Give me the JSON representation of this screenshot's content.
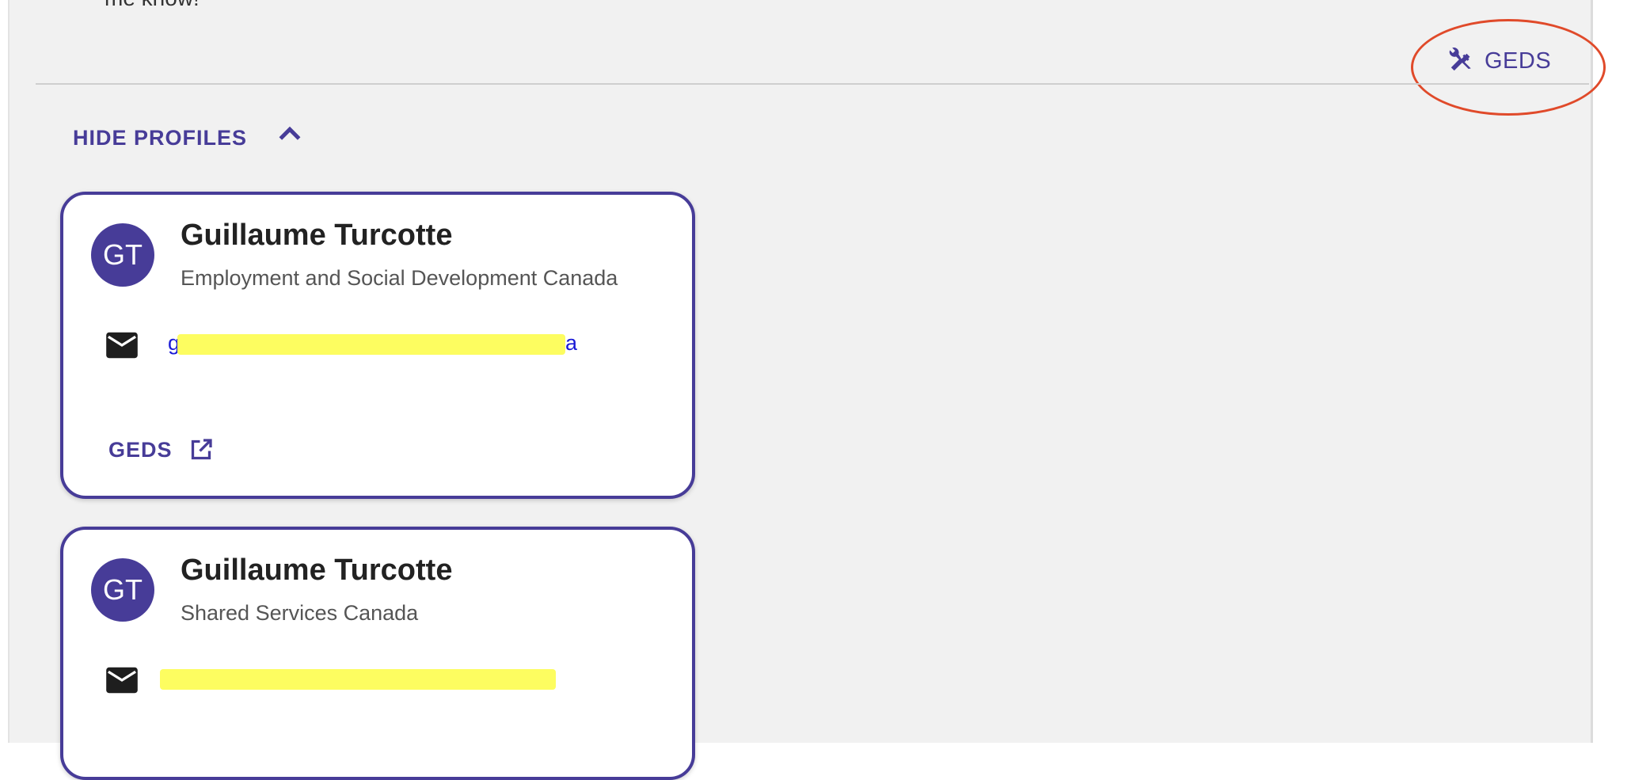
{
  "top_text": "me know!",
  "top_button": {
    "label": "GEDS",
    "icon": "tools-icon"
  },
  "annotation": {
    "color": "#e04a2a"
  },
  "hide_profiles": {
    "label": "HIDE PROFILES",
    "icon": "chevron-up-icon"
  },
  "colors": {
    "accent": "#473c98",
    "panel_bg": "#f1f1f1",
    "link": "#1a1ad6",
    "redaction": "#fdfd60"
  },
  "profiles": [
    {
      "initials": "GT",
      "name": "Guillaume Turcotte",
      "department": "Employment and Social Development Canada",
      "email_visible_start": "g",
      "email_visible_end": "a",
      "geds_label": "GEDS",
      "geds_icon": "open-in-new-icon"
    },
    {
      "initials": "GT",
      "name": "Guillaume Turcotte",
      "department": "Shared Services Canada"
    }
  ]
}
